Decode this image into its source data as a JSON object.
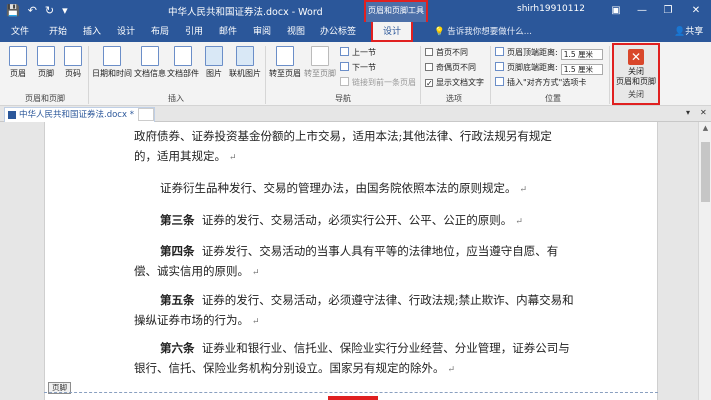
{
  "titlebar": {
    "doc_title": "中华人民共和国证券法.docx - Word",
    "context_group": "页眉和页脚工具",
    "user": "shirh19910112",
    "icons": [
      "save-icon",
      "undo-icon",
      "redo-icon",
      "customize-qat-icon"
    ],
    "controls": [
      "ribbon-display-icon",
      "minimize-icon",
      "restore-icon",
      "close-icon"
    ]
  },
  "tabs": {
    "items": [
      "文件",
      "开始",
      "插入",
      "设计",
      "布局",
      "引用",
      "邮件",
      "审阅",
      "视图",
      "办公标签",
      "设计"
    ],
    "active_index": 10,
    "tell_me": "告诉我你想要做什么...",
    "share": "共享"
  },
  "ribbon": {
    "header_footer": {
      "label": "页眉和页脚",
      "buttons": [
        "页眉",
        "页脚",
        "页码"
      ]
    },
    "insert": {
      "label": "插入",
      "buttons": [
        "日期和时间",
        "文档信息",
        "文档部件",
        "图片",
        "联机图片"
      ]
    },
    "navigation": {
      "label": "导航",
      "goto_header": "转至页眉",
      "goto_footer": "转至页脚",
      "prev": "上一节",
      "next": "下一节",
      "link_prev": "链接到前一条页眉"
    },
    "options": {
      "label": "选项",
      "items": [
        {
          "label": "首页不同",
          "checked": false
        },
        {
          "label": "奇偶页不同",
          "checked": false
        },
        {
          "label": "显示文档文字",
          "checked": true
        }
      ]
    },
    "position": {
      "label": "位置",
      "header_top_label": "页眉顶端距离:",
      "header_top_value": "1.5 厘米",
      "footer_bottom_label": "页脚底端距离:",
      "footer_bottom_value": "1.5 厘米",
      "align_tab": "插入\"对齐方式\"选项卡"
    },
    "close": {
      "label": "关闭",
      "button_line1": "关闭",
      "button_line2": "页眉和页脚"
    }
  },
  "docbar": {
    "tab_label": "中华人民共和国证券法.docx *",
    "tab_close": "×"
  },
  "document": {
    "paragraphs": [
      {
        "lead": "",
        "text": "政府债券、证券投资基金份额的上市交易，适用本法;其他法律、行政法规另有规定的，适用其规定。"
      },
      {
        "lead": "",
        "text": "证券衍生品种发行、交易的管理办法，由国务院依照本法的原则规定。"
      },
      {
        "lead": "第三条",
        "text": "证券的发行、交易活动，必须实行公开、公平、公正的原则。"
      },
      {
        "lead": "第四条",
        "text": "证券发行、交易活动的当事人具有平等的法律地位，应当遵守自愿、有偿、诚实信用的原则。"
      },
      {
        "lead": "第五条",
        "text": "证券的发行、交易活动，必须遵守法律、行政法规;禁止欺诈、内幕交易和操纵证券市场的行为。"
      },
      {
        "lead": "第六条",
        "text": "证券业和银行业、信托业、保险业实行分业经营、分业管理，证券公司与银行、信托、保险业务机构分别设立。国家另有规定的除外。"
      }
    ],
    "paragraph_mark": "↵",
    "footer_tag": "页脚"
  }
}
